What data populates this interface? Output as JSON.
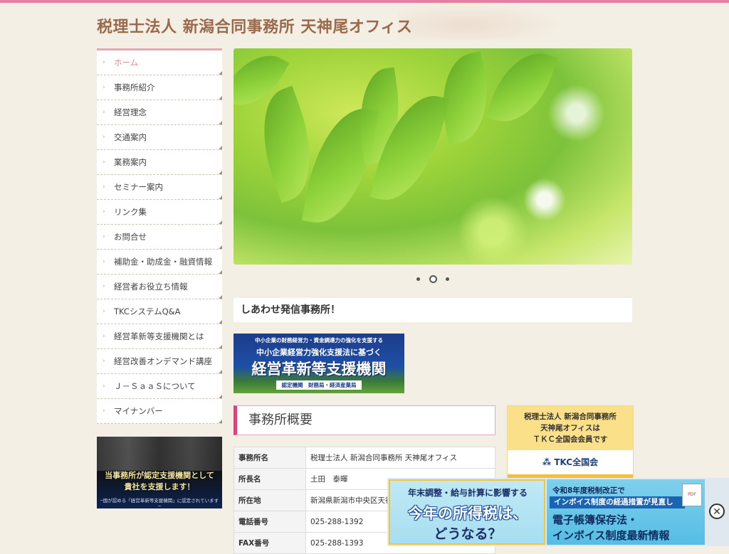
{
  "header": {
    "title": "税理士法人 新潟合同事務所 天神尾オフィス"
  },
  "nav": {
    "items": [
      {
        "label": "ホーム",
        "active": true
      },
      {
        "label": "事務所紹介"
      },
      {
        "label": "経営理念"
      },
      {
        "label": "交通案内"
      },
      {
        "label": "業務案内"
      },
      {
        "label": "セミナー案内"
      },
      {
        "label": "リンク集"
      },
      {
        "label": "お問合せ"
      },
      {
        "label": "補助金・助成金・融資情報"
      },
      {
        "label": "経営者お役立ち情報"
      },
      {
        "label": "TKCシステムQ&A"
      },
      {
        "label": "経営革新等支援機関とは"
      },
      {
        "label": "経営改善オンデマンド講座"
      },
      {
        "label": "Ｊ－ＳａａＳについて"
      },
      {
        "label": "マイナンバー"
      }
    ]
  },
  "promo": {
    "line1": "当事務所が認定支援機関として",
    "line2": "貴社を支援します！",
    "line3": "─国が認める「経営革新等支援機関」に認定されています─"
  },
  "slider": {
    "count": 3,
    "active_index": 1
  },
  "tagline": "しあわせ発信事務所！",
  "banner": {
    "line1": "中小企業の財務経営力・資金調達力の強化を支援する",
    "line2": "中小企業経営力強化支援法に基づく",
    "line3": "経営革新等支援機関",
    "line4": "認定機関　財務局・経済産業局"
  },
  "overview": {
    "heading": "事務所概要",
    "rows": [
      {
        "key": "事務所名",
        "value": "税理士法人 新潟合同事務所 天神尾オフィス"
      },
      {
        "key": "所長名",
        "value": "土田　泰暉"
      },
      {
        "key": "所在地",
        "value": "新潟県新潟市中央区天神尾"
      },
      {
        "key": "電話番号",
        "value": "025-288-1392"
      },
      {
        "key": "FAX番号",
        "value": "025-288-1393"
      }
    ]
  },
  "tkc": {
    "line1": "税理士法人 新潟合同事務所",
    "line2": "天神尾オフィスは",
    "line3": "ＴＫＣ全国会会員です",
    "logo": "TKC全国会"
  },
  "ad": {
    "left1": "年末調整・給与計算に影響する",
    "left2": "今年の所得税は、",
    "left3": "どうなる？",
    "right1": "令和8年度税制改正で",
    "right2": "インボイス制度の経過措置が見直し",
    "right3": "電子帳簿保存法・",
    "right4": "インボイス制度最新情報",
    "pdf": "PDF"
  },
  "icons": {
    "nav_arrow": "chevron-right-icon",
    "ad_close": "close-icon"
  },
  "colors": {
    "accent": "#e47fa3",
    "title": "#9a6a4d",
    "nav_active": "#e28a8c",
    "section_border": "#d5467f"
  }
}
